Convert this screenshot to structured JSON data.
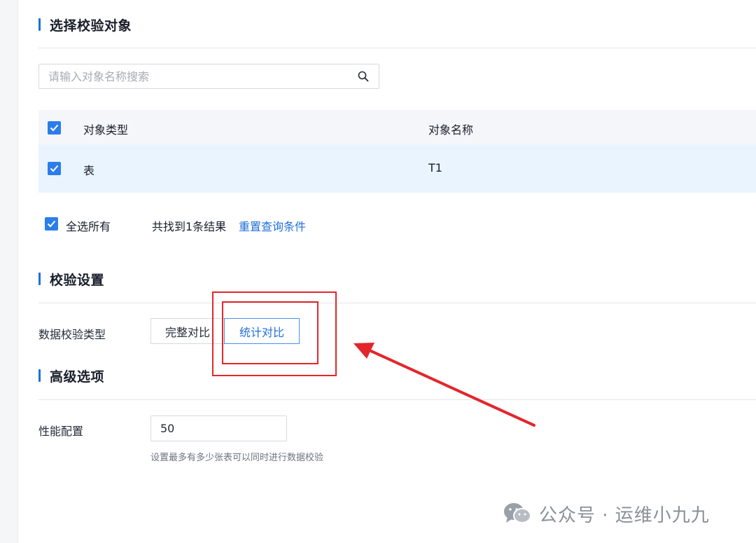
{
  "sections": {
    "select_objects": "选择校验对象",
    "verify_settings": "校验设置",
    "advanced": "高级选项"
  },
  "search": {
    "placeholder": "请输入对象名称搜索",
    "icon": "search-icon"
  },
  "table": {
    "columns": [
      "对象类型",
      "对象名称"
    ],
    "rows": [
      {
        "checked": true,
        "type": "表",
        "name": "T1"
      }
    ],
    "header_checked": true
  },
  "selection": {
    "select_all_label": "全选所有",
    "select_all_checked": true,
    "result_text": "共找到1条结果",
    "reset_link": "重置查询条件"
  },
  "verify": {
    "type_label": "数据校验类型",
    "options": [
      "完整对比",
      "统计对比"
    ],
    "selected": "统计对比"
  },
  "performance": {
    "label": "性能配置",
    "value": "50",
    "hint": "设置最多有多少张表可以同时进行数据校验"
  },
  "watermark": {
    "text": "公众号 · 运维小九九"
  },
  "colors": {
    "accent": "#1d6fe0",
    "link": "#1f6fd9",
    "checkbox": "#2b7de9",
    "selected_row": "#eaf4fe",
    "header_bg": "#f5f6f9",
    "annotation_red": "#e3262c"
  }
}
